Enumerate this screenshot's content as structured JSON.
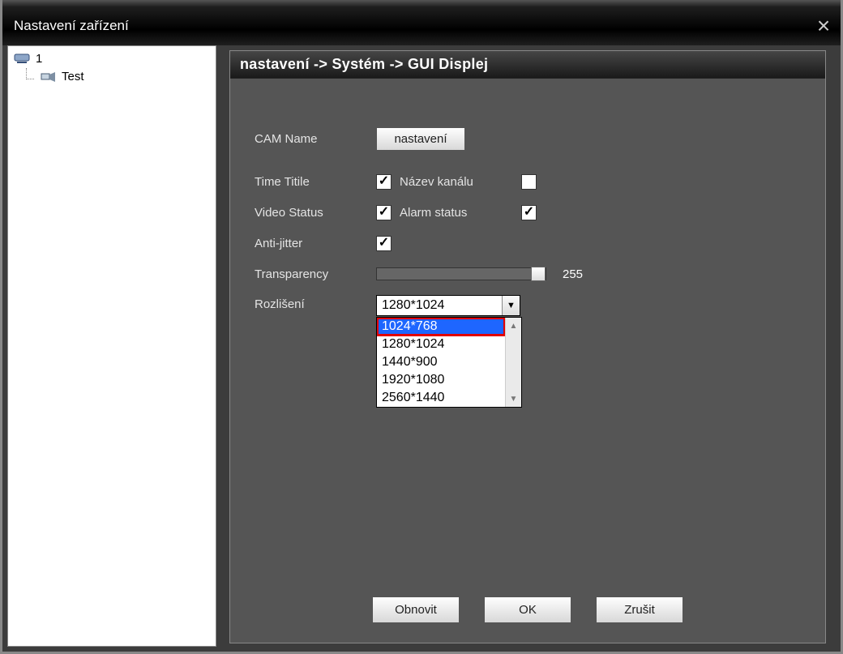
{
  "window": {
    "title": "Nastavení zařízení"
  },
  "tree": {
    "root_label": "1",
    "child_label": "Test"
  },
  "breadcrumb": "nastavení -> Systém -> GUI Displej",
  "form": {
    "cam_name_label": "CAM Name",
    "cam_name_button": "nastavení",
    "time_title_label": "Time Titile",
    "channel_name_label": "Název kanálu",
    "video_status_label": "Video Status",
    "alarm_status_label": "Alarm status",
    "anti_jitter_label": "Anti-jitter",
    "transparency_label": "Transparency",
    "transparency_value": "255",
    "resolution_label": "Rozlišení",
    "resolution_selected": "1280*1024",
    "resolution_options": [
      "1024*768",
      "1280*1024",
      "1440*900",
      "1920*1080",
      "2560*1440"
    ]
  },
  "checks": {
    "time_title": true,
    "channel_name": false,
    "video_status": true,
    "alarm_status": true,
    "anti_jitter": true
  },
  "buttons": {
    "refresh": "Obnovit",
    "ok": "OK",
    "cancel": "Zrušit"
  }
}
